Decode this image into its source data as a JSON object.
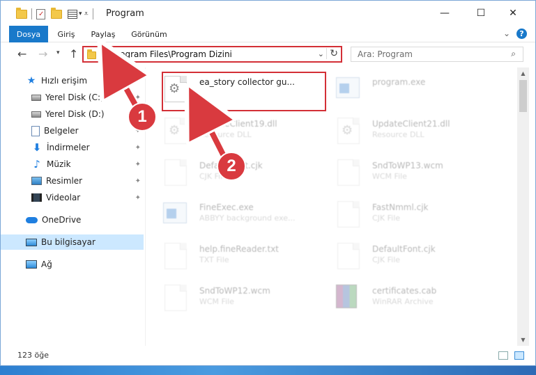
{
  "window": {
    "title": "Program",
    "minimize": "—",
    "maximize": "☐",
    "close": "✕"
  },
  "ribbon": {
    "tabs": [
      "Dosya",
      "Giriş",
      "Paylaş",
      "Görünüm"
    ],
    "help": "?"
  },
  "address": {
    "path": "C:\\Program Files\\Program Dizini",
    "refresh": "↻",
    "dropdown": "⌄"
  },
  "search": {
    "placeholder": "Ara: Program",
    "icon": "⌕"
  },
  "sidebar": {
    "items": [
      {
        "label": "Hızlı erişim",
        "icon": "star-icon"
      },
      {
        "label": "Yerel Disk (C:)",
        "icon": "disk-icon",
        "pinned": true
      },
      {
        "label": "Yerel Disk (D:)",
        "icon": "disk-icon",
        "pinned": true
      },
      {
        "label": "Belgeler",
        "icon": "document-icon",
        "pinned": true
      },
      {
        "label": "İndirmeler",
        "icon": "download-icon",
        "pinned": true
      },
      {
        "label": "Müzik",
        "icon": "music-icon",
        "pinned": true
      },
      {
        "label": "Resimler",
        "icon": "picture-icon",
        "pinned": true
      },
      {
        "label": "Videolar",
        "icon": "video-icon",
        "pinned": true
      },
      {
        "label": "OneDrive",
        "icon": "cloud-icon"
      },
      {
        "label": "Bu bilgisayar",
        "icon": "computer-icon",
        "selected": true
      },
      {
        "label": "Ağ",
        "icon": "network-icon"
      }
    ],
    "pin_glyph": "📌"
  },
  "files": [
    {
      "name": "ea_story collector gu...",
      "type": "",
      "icon": "gear-file-icon",
      "highlight": true
    },
    {
      "name": "program.exe",
      "type": "",
      "icon": "exe-icon"
    },
    {
      "name": "UpdateClient19.dll",
      "type": "Resource DLL",
      "icon": "gear-file-icon"
    },
    {
      "name": "UpdateClient21.dll",
      "type": "Resource DLL",
      "icon": "gear-file-icon"
    },
    {
      "name": "DefaultFont.cjk",
      "type": "CJK File",
      "icon": "file-icon"
    },
    {
      "name": "SndToWP13.wcm",
      "type": "WCM File",
      "icon": "file-icon"
    },
    {
      "name": "FineExec.exe",
      "type": "ABBYY background exe...",
      "icon": "exe-icon"
    },
    {
      "name": "FastNmml.cjk",
      "type": "CJK File",
      "icon": "file-icon"
    },
    {
      "name": "help.fineReader.txt",
      "type": "TXT File",
      "icon": "file-icon"
    },
    {
      "name": "DefaultFont.cjk",
      "type": "CJK File",
      "icon": "file-icon"
    },
    {
      "name": "SndToWP12.wcm",
      "type": "WCM File",
      "icon": "file-icon"
    },
    {
      "name": "certificates.cab",
      "type": "WinRAR Archive",
      "icon": "rar-icon"
    }
  ],
  "status": {
    "count": "123 öğe"
  },
  "annotations": {
    "step1": "1",
    "step2": "2",
    "color": "#d93a3f"
  }
}
